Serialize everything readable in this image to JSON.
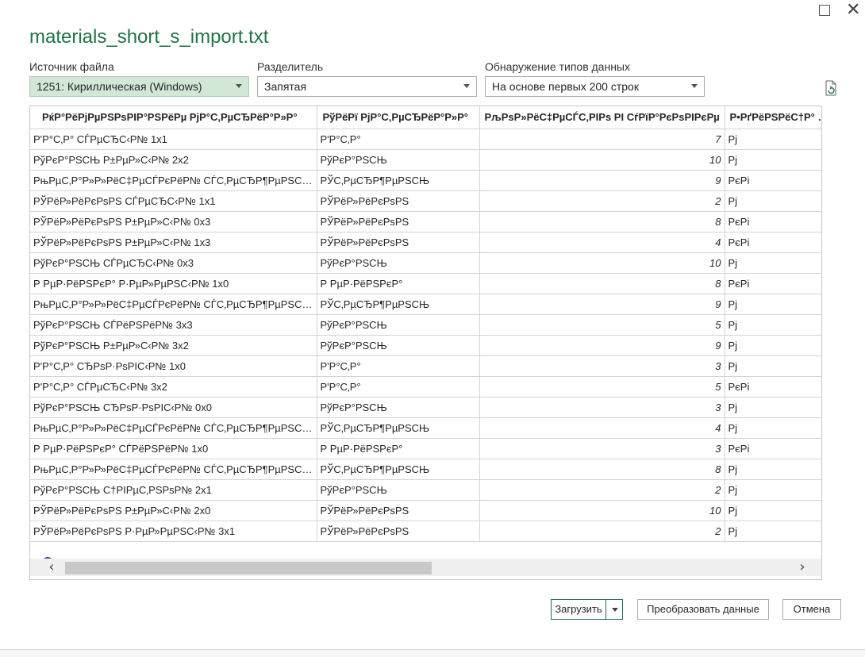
{
  "window": {
    "title": "materials_short_s_import.txt"
  },
  "controls": {
    "source_label": "Источник файла",
    "source_value": "1251: Кириллическая (Windows)",
    "delimiter_label": "Разделитель",
    "delimiter_value": "Запятая",
    "detect_label": "Обнаружение типов данных",
    "detect_value": "На основе первых 200 строк"
  },
  "table": {
    "headers": [
      "РќР°РёРјРµРЅРѕРІР°РЅРёРµ РјР°С‚РµСЂРёР°Р»Р°",
      "РўРёРї РјР°С‚РµСЂРёР°Р»Р°",
      "РљРѕР»РёС‡РµСЃС‚РІРѕ РІ СѓРїР°РєРѕРІРєРµ",
      "Р•РґРёРЅРёС†Р° РёР·РјРµСЂРµРЅРёСЏ"
    ],
    "rows": [
      [
        "Р'Р°С‚Р° СЃРµСЂС‹Р№ 1x1",
        "Р'Р°С‚Р°",
        "7",
        "Рј"
      ],
      [
        "РўРєР°РЅСЊ Р±РµР»С‹Р№ 2x2",
        "РўРєР°РЅСЊ",
        "10",
        "Рј"
      ],
      [
        "РњРµС‚Р°Р»Р»РёС‡РµСЃРєРёР№ СЃС‚РµСЂР¶РµРЅСЊ…",
        "РЎС‚РµСЂР¶РµРЅСЊ",
        "9",
        "РєРі"
      ],
      [
        "РЎРёР»РёРєРѕРЅ СЃРµСЂС‹Р№ 1x1",
        "РЎРёР»РёРєРѕРЅ",
        "2",
        "Рј"
      ],
      [
        "РЎРёР»РёРєРѕРЅ Р±РµР»С‹Р№ 0x3",
        "РЎРёР»РёРєРѕРЅ",
        "8",
        "РєРі"
      ],
      [
        "РЎРёР»РёРєРѕРЅ Р±РµР»С‹Р№ 1x3",
        "РЎРёР»РёРєРѕРЅ",
        "4",
        "РєРі"
      ],
      [
        "РўРєР°РЅСЊ СЃРµСЂС‹Р№ 0x3",
        "РўРєР°РЅСЊ",
        "10",
        "Рј"
      ],
      [
        "Р РµР·РёРЅРєР° Р·РµР»РµРЅС‹Р№ 1x0",
        "Р РµР·РёРЅРєР°",
        "8",
        "РєРі"
      ],
      [
        "РњРµС‚Р°Р»Р»РёС‡РµСЃРєРёР№ СЃС‚РµСЂР¶РµРЅСЊ…",
        "РЎС‚РµСЂР¶РµРЅСЊ",
        "9",
        "Рј"
      ],
      [
        "РўРєР°РЅСЊ СЃРёРЅРёР№ 3x3",
        "РўРєР°РЅСЊ",
        "5",
        "Рј"
      ],
      [
        "РўРєР°РЅСЊ Р±РµР»С‹Р№ 3x2",
        "РўРєР°РЅСЊ",
        "9",
        "Рј"
      ],
      [
        "Р'Р°С‚Р° СЂРѕР·РѕРІС‹Р№ 1x0",
        "Р'Р°С‚Р°",
        "3",
        "Рј"
      ],
      [
        "Р'Р°С‚Р° СЃРµСЂС‹Р№ 3x2",
        "Р'Р°С‚Р°",
        "5",
        "РєРі"
      ],
      [
        "РўРєР°РЅСЊ СЂРѕР·РѕРІС‹Р№ 0x0",
        "РўРєР°РЅСЊ",
        "3",
        "Рј"
      ],
      [
        "РњРµС‚Р°Р»Р»РёС‡РµСЃРєРёР№ СЃС‚РµСЂР¶РµРЅСЊ…",
        "РЎС‚РµСЂР¶РµРЅСЊ",
        "4",
        "Рј"
      ],
      [
        "Р РµР·РёРЅРєР° СЃРёРЅРёР№ 1x0",
        "Р РµР·РёРЅРєР°",
        "3",
        "РєРі"
      ],
      [
        "РњРµС‚Р°Р»Р»РёС‡РµСЃРєРёР№ СЃС‚РµСЂР¶РµРЅСЊ…",
        "РЎС‚РµСЂР¶РµРЅСЊ",
        "8",
        "Рј"
      ],
      [
        "РўРєР°РЅСЊ С†РІРµС‚РЅРѕР№ 2x1",
        "РўРєР°РЅСЊ",
        "2",
        "Рј"
      ],
      [
        "РЎРёР»РёРєРѕРЅ Р±РµР»С‹Р№ 2x0",
        "РЎРёР»РёРєРѕРЅ",
        "10",
        "Рј"
      ],
      [
        "РЎРёР»РёРєРѕРЅ Р·РµР»РµРЅС‹Р№ 3x1",
        "РЎРёР»РёРєРѕРЅ",
        "2",
        "Рј"
      ]
    ]
  },
  "buttons": {
    "load": "Загрузить",
    "transform": "Преобразовать данные",
    "cancel": "Отмена"
  },
  "icons": {
    "maximize": "maximize-icon",
    "close": "close-icon",
    "refresh": "refresh-file-icon",
    "info": "info-icon"
  },
  "colors": {
    "accent": "#217346",
    "selected_dropdown_bg": "#d2e7d6"
  }
}
